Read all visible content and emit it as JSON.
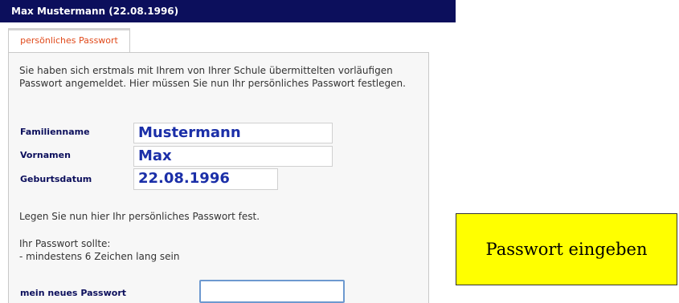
{
  "header": {
    "title": "Max Mustermann (22.08.1996)"
  },
  "tab": {
    "label": "persönliches Passwort"
  },
  "intro": {
    "text": "Sie haben sich erstmals mit Ihrem von Ihrer Schule übermittelten vorläufigen Passwort angemeldet. Hier müssen Sie nun Ihr persönliches Passwort festlegen."
  },
  "fields": {
    "familienname": {
      "label": "Familienname",
      "value": "Mustermann"
    },
    "vornamen": {
      "label": "Vornamen",
      "value": "Max"
    },
    "geburtsdatum": {
      "label": "Geburtsdatum",
      "value": "22.08.1996"
    }
  },
  "instructions": {
    "line1": "Legen Sie nun hier Ihr persönliches Passwort fest.",
    "line2": "Ihr Passwort sollte:",
    "line3": "- mindestens 6 Zeichen lang sein"
  },
  "password": {
    "label": "mein neues Passwort",
    "value": ""
  },
  "note": {
    "text": "Passwort eingeben"
  },
  "colors": {
    "titlebar": "#0c0f5c",
    "tab_text": "#e0491a",
    "field_value": "#1b2fa8",
    "note_background": "#ffff00",
    "input_border": "#6d99cf"
  }
}
